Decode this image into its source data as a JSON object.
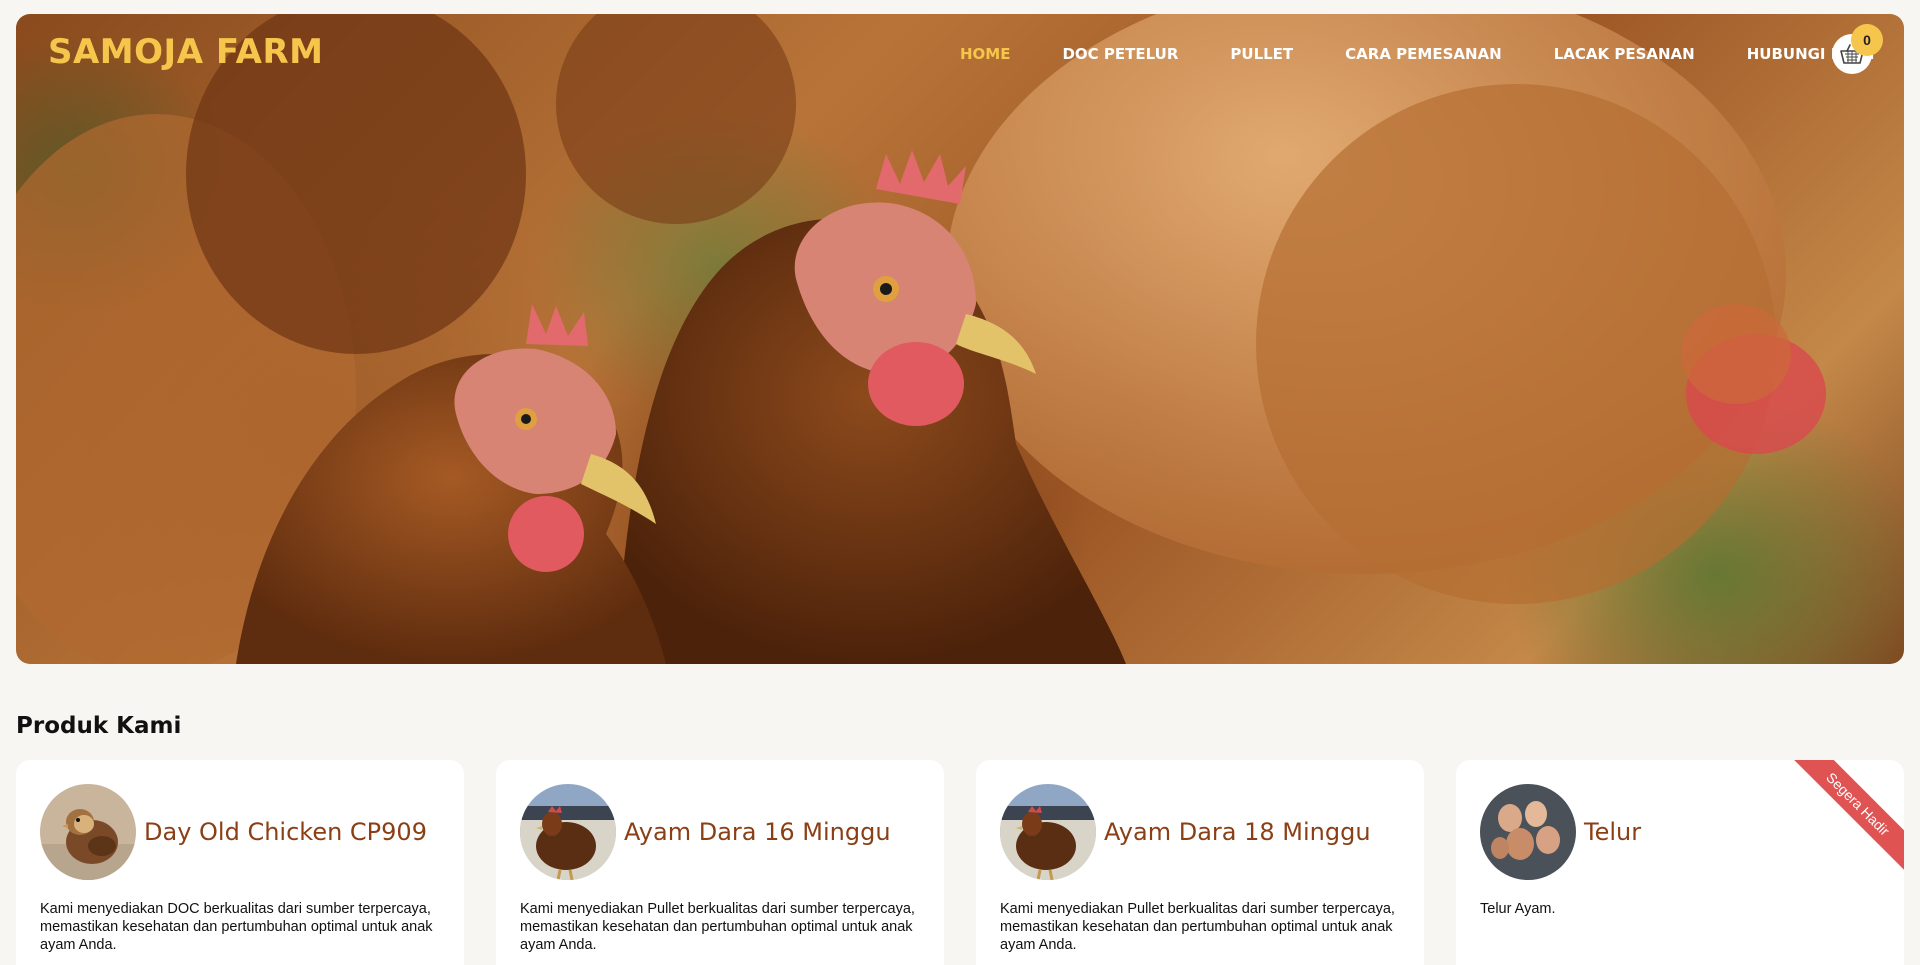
{
  "brand": "SAMOJA FARM",
  "nav": {
    "home": "HOME",
    "doc_petelur": "DOC PETELUR",
    "pullet": "PULLET",
    "cara_pemesanan": "CARA PEMESANAN",
    "lacak_pesanan": "LACAK PESANAN",
    "hubungi_kami": "HUBUNGI KAMI"
  },
  "cart": {
    "count": "0",
    "icon": "basket-icon"
  },
  "section_title": "Produk Kami",
  "products": [
    {
      "title": "Day Old Chicken CP909",
      "description": "Kami menyediakan DOC berkualitas dari sumber terpercaya, memastikan kesehatan dan pertumbuhan optimal untuk anak ayam Anda."
    },
    {
      "title": "Ayam Dara 16 Minggu",
      "description": "Kami menyediakan Pullet berkualitas dari sumber terpercaya, memastikan kesehatan dan pertumbuhan optimal untuk anak ayam Anda."
    },
    {
      "title": "Ayam Dara 18 Minggu",
      "description": "Kami menyediakan Pullet berkualitas dari sumber terpercaya, memastikan kesehatan dan pertumbuhan optimal untuk anak ayam Anda."
    },
    {
      "title": "Telur",
      "description": "Telur Ayam.",
      "ribbon": "Segera Hadir"
    }
  ],
  "colors": {
    "accent": "#f6c64c",
    "title_brown": "#8b3f15",
    "ribbon_red": "#e05353",
    "background": "#f7f6f2"
  }
}
